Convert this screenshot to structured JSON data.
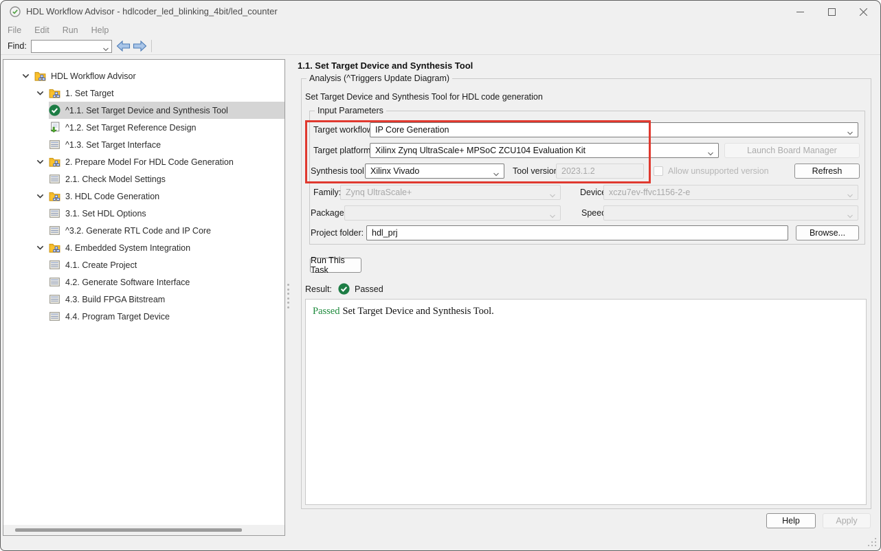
{
  "titlebar": {
    "title": "HDL Workflow Advisor - hdlcoder_led_blinking_4bit/led_counter"
  },
  "menu": {
    "items": [
      "File",
      "Edit",
      "Run",
      "Help"
    ]
  },
  "findbar": {
    "label": "Find:",
    "value": ""
  },
  "tree": {
    "items": [
      {
        "level": 0,
        "expander": true,
        "icon": "folder",
        "label": "HDL Workflow Advisor",
        "selected": false
      },
      {
        "level": 1,
        "expander": true,
        "icon": "folder",
        "label": "1. Set Target",
        "selected": false
      },
      {
        "level": 2,
        "expander": false,
        "icon": "passed",
        "label": "^1.1. Set Target Device and Synthesis Tool",
        "selected": true
      },
      {
        "level": 2,
        "expander": false,
        "icon": "docarrow",
        "label": "^1.2. Set Target Reference Design",
        "selected": false
      },
      {
        "level": 2,
        "expander": false,
        "icon": "task",
        "label": "^1.3. Set Target Interface",
        "selected": false
      },
      {
        "level": 1,
        "expander": true,
        "icon": "folder",
        "label": "2. Prepare Model For HDL Code Generation",
        "selected": false
      },
      {
        "level": 2,
        "expander": false,
        "icon": "task",
        "label": "2.1. Check Model Settings",
        "selected": false
      },
      {
        "level": 1,
        "expander": true,
        "icon": "folder",
        "label": "3. HDL Code Generation",
        "selected": false
      },
      {
        "level": 2,
        "expander": false,
        "icon": "task",
        "label": "3.1. Set HDL Options",
        "selected": false
      },
      {
        "level": 2,
        "expander": false,
        "icon": "task",
        "label": "^3.2. Generate RTL Code and IP Core",
        "selected": false
      },
      {
        "level": 1,
        "expander": true,
        "icon": "folder",
        "label": "4. Embedded System Integration",
        "selected": false
      },
      {
        "level": 2,
        "expander": false,
        "icon": "task",
        "label": "4.1. Create Project",
        "selected": false
      },
      {
        "level": 2,
        "expander": false,
        "icon": "task",
        "label": "4.2. Generate Software Interface",
        "selected": false
      },
      {
        "level": 2,
        "expander": false,
        "icon": "task",
        "label": "4.3. Build FPGA Bitstream",
        "selected": false
      },
      {
        "level": 2,
        "expander": false,
        "icon": "task",
        "label": "4.4. Program Target Device",
        "selected": false
      }
    ]
  },
  "detail": {
    "heading": "1.1. Set Target Device and Synthesis Tool",
    "analysis_group": "Analysis (^Triggers Update Diagram)",
    "description": "Set Target Device and Synthesis Tool for HDL code generation",
    "input_group": "Input Parameters",
    "target_workflow_label": "Target workflow:",
    "target_workflow_value": "IP Core Generation",
    "target_platform_label": "Target platform:",
    "target_platform_value": "Xilinx Zynq UltraScale+ MPSoC ZCU104 Evaluation Kit",
    "launch_board_manager_label": "Launch Board Manager",
    "synthesis_tool_label": "Synthesis tool:",
    "synthesis_tool_value": "Xilinx Vivado",
    "tool_version_label": "Tool version:",
    "tool_version_value": "2023.1.2",
    "allow_unsupported_label": "Allow unsupported version",
    "refresh_label": "Refresh",
    "family_label": "Family:",
    "family_value": "Zynq UltraScale+",
    "device_label": "Device:",
    "device_value": "xczu7ev-ffvc1156-2-e",
    "package_label": "Package:",
    "package_value": "",
    "speed_label": "Speed:",
    "speed_value": "",
    "project_folder_label": "Project folder:",
    "project_folder_value": "hdl_prj",
    "browse_label": "Browse...",
    "run_task_label": "Run This Task",
    "result_label": "Result:",
    "result_status": "Passed",
    "output_status": "Passed",
    "output_text": "Set Target Device and Synthesis Tool."
  },
  "colors": {
    "status_green": "#1d7d45",
    "annotation_red": "#e0392f",
    "panel_bg": "#f0f0f0",
    "selection_grey": "#d5d5d5"
  }
}
